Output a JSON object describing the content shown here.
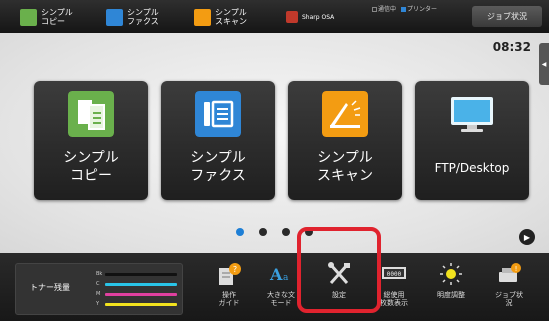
{
  "top_bar": {
    "items": [
      {
        "label": "シンプル\nコピー",
        "icon": "copy-icon",
        "color": "#6ab04c"
      },
      {
        "label": "シンプル\nファクス",
        "icon": "fax-icon",
        "color": "#2f86d6"
      },
      {
        "label": "シンプル\nスキャン",
        "icon": "scan-icon",
        "color": "#f39c12"
      },
      {
        "label": "Sharp OSA",
        "icon": "osa-icon",
        "color": "#c0392b"
      }
    ],
    "status_items": [
      "通信中",
      "プリンター"
    ],
    "job_status_label": "ジョブ状況"
  },
  "clock": "08:32",
  "side_tab_icon": "collapse-left-icon",
  "apps": [
    {
      "label": "シンプル\nコピー",
      "icon": "copy-icon",
      "color": "#6ab04c"
    },
    {
      "label": "シンプル\nファクス",
      "icon": "fax-icon",
      "color": "#2f86d6"
    },
    {
      "label": "シンプル\nスキャン",
      "icon": "scan-icon",
      "color": "#f39c12"
    },
    {
      "label": "FTP/Desktop",
      "icon": "monitor-icon",
      "color": "#4ab2e8"
    }
  ],
  "pager": {
    "total": 4,
    "active": 0,
    "next_icon": "play-icon"
  },
  "toner": {
    "label": "トナー残量",
    "rows": [
      {
        "letter": "Bk",
        "level": 0.9,
        "color": "#111111"
      },
      {
        "letter": "C",
        "level": 0.9,
        "color": "#29c4e8"
      },
      {
        "letter": "M",
        "level": 0.9,
        "color": "#e040a0"
      },
      {
        "letter": "Y",
        "level": 0.9,
        "color": "#f2e21e"
      }
    ]
  },
  "bottom_buttons": [
    {
      "label": "操作\nガイド",
      "icon": "guide-icon"
    },
    {
      "label": "大きな文\nモード",
      "icon": "large-text-icon"
    },
    {
      "label": "設定",
      "icon": "settings-icon"
    },
    {
      "label": "総使用\n枚数表示",
      "icon": "counter-icon"
    },
    {
      "label": "明度調整",
      "icon": "brightness-icon"
    },
    {
      "label": "ジョブ状\n況",
      "icon": "job-status-icon"
    }
  ],
  "highlight_color": "#e0232e"
}
